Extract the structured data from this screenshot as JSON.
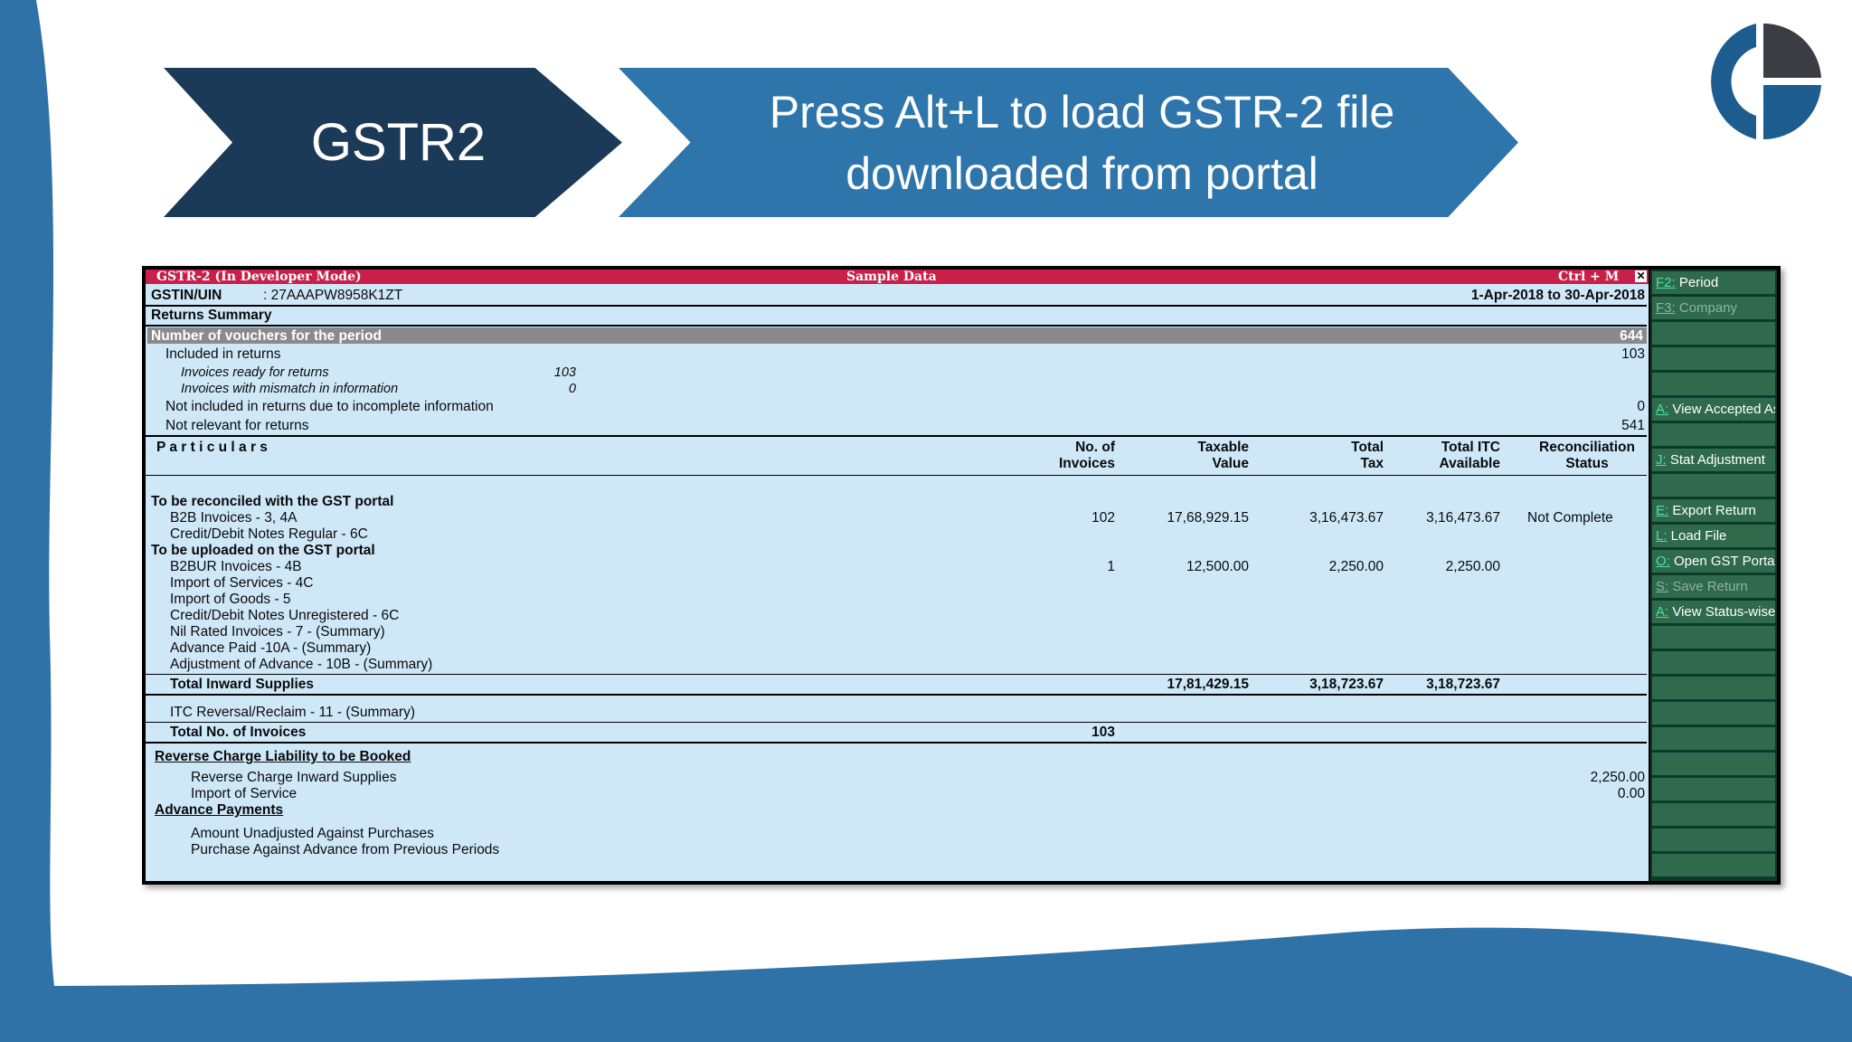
{
  "slide": {
    "step_label": "GSTR2",
    "instruction_line1": "Press Alt+L to load GSTR-2 file",
    "instruction_line2": "downloaded from portal",
    "colors": {
      "dark_navy": "#1b3a58",
      "blue": "#2e75ab",
      "tally_title": "#c82048",
      "tally_bg": "#cfe8f8",
      "side_btn": "#2f6a4d"
    },
    "logo_icon": "company-logo-icon"
  },
  "window": {
    "title": "GSTR-2 (In Developer Mode)",
    "center_title": "Sample Data",
    "shortcut": "Ctrl + M",
    "close_glyph": "✕",
    "gstin_label": "GSTIN/UIN",
    "gstin_value": ": 27AAAPW8958K1ZT",
    "period": "1-Apr-2018 to 30-Apr-2018",
    "returns_summary": "Returns Summary"
  },
  "vouchers": {
    "header": "Number of vouchers for the period",
    "header_value": "644",
    "included": "Included in returns",
    "included_value": "103",
    "ready": "Invoices ready for returns",
    "ready_value": "103",
    "mismatch": "Invoices with mismatch in information",
    "mismatch_value": "0",
    "not_included": "Not included in returns due to incomplete information",
    "not_included_value": "0",
    "not_relevant": "Not relevant for returns",
    "not_relevant_value": "541"
  },
  "table": {
    "headers": {
      "particulars": "P a r t i c u l a r s",
      "invoices_1": "No. of",
      "invoices_2": "Invoices",
      "taxable_1": "Taxable",
      "taxable_2": "Value",
      "tax_1": "Total",
      "tax_2": "Tax",
      "itc_1": "Total ITC",
      "itc_2": "Available",
      "recon_1": "Reconciliation",
      "recon_2": "Status"
    },
    "reconcile_heading": "To be reconciled with the GST portal",
    "b2b": {
      "label": "B2B Invoices - 3, 4A",
      "invoices": "102",
      "taxable": "17,68,929.15",
      "tax": "3,16,473.67",
      "itc": "3,16,473.67",
      "status": "Not Complete"
    },
    "cdn_regular": "Credit/Debit Notes Regular - 6C",
    "upload_heading": "To be uploaded on the GST portal",
    "b2bur": {
      "label": "B2BUR Invoices - 4B",
      "invoices": "1",
      "taxable": "12,500.00",
      "tax": "2,250.00",
      "itc": "2,250.00"
    },
    "import_services": "Import of Services - 4C",
    "import_goods": "Import of Goods - 5",
    "cdn_unregistered": "Credit/Debit Notes Unregistered - 6C",
    "nil_rated": "Nil Rated Invoices - 7 - (Summary)",
    "advance_paid": "Advance Paid -10A - (Summary)",
    "adjustment_advance": "Adjustment of Advance - 10B - (Summary)",
    "total_inward": {
      "label": "Total Inward Supplies",
      "taxable": "17,81,429.15",
      "tax": "3,18,723.67",
      "itc": "3,18,723.67"
    },
    "itc_reversal": "ITC Reversal/Reclaim - 11 - (Summary)",
    "total_invoices": {
      "label": "Total No. of Invoices",
      "value": "103"
    }
  },
  "reverse_charge": {
    "heading": "Reverse Charge Liability to be Booked",
    "inward_supplies": "Reverse Charge Inward Supplies",
    "inward_supplies_value": "2,250.00",
    "import_service": "Import of Service",
    "import_service_value": "0.00",
    "advance_heading": "Advance Payments",
    "unadjusted": "Amount Unadjusted Against Purchases",
    "previous_periods": "Purchase Against Advance from Previous Periods"
  },
  "sidebar": [
    {
      "key": "F2:",
      "label": "Period",
      "enabled": true
    },
    {
      "key": "F3:",
      "label": "Company",
      "enabled": false
    },
    {
      "key": "",
      "label": "",
      "enabled": true
    },
    {
      "key": "",
      "label": "",
      "enabled": true
    },
    {
      "key": "",
      "label": "",
      "enabled": true
    },
    {
      "key": "A:",
      "label": "View Accepted As",
      "enabled": true
    },
    {
      "key": "",
      "label": "",
      "enabled": true
    },
    {
      "key": "J:",
      "label": "Stat Adjustment",
      "enabled": true
    },
    {
      "key": "",
      "label": "",
      "enabled": true
    },
    {
      "key": "E:",
      "label": "Export Return",
      "enabled": true
    },
    {
      "key": "L:",
      "label": "Load File",
      "enabled": true
    },
    {
      "key": "O:",
      "label": "Open GST Portal",
      "enabled": true
    },
    {
      "key": "S:",
      "label": "Save Return",
      "enabled": false
    },
    {
      "key": "A:",
      "label": "View Status-wise",
      "enabled": true
    },
    {
      "key": "",
      "label": "",
      "enabled": true
    },
    {
      "key": "",
      "label": "",
      "enabled": true
    },
    {
      "key": "",
      "label": "",
      "enabled": true
    },
    {
      "key": "",
      "label": "",
      "enabled": true
    },
    {
      "key": "",
      "label": "",
      "enabled": true
    },
    {
      "key": "",
      "label": "",
      "enabled": true
    },
    {
      "key": "",
      "label": "",
      "enabled": true
    },
    {
      "key": "",
      "label": "",
      "enabled": true
    },
    {
      "key": "",
      "label": "",
      "enabled": true
    },
    {
      "key": "",
      "label": "",
      "enabled": true
    }
  ]
}
